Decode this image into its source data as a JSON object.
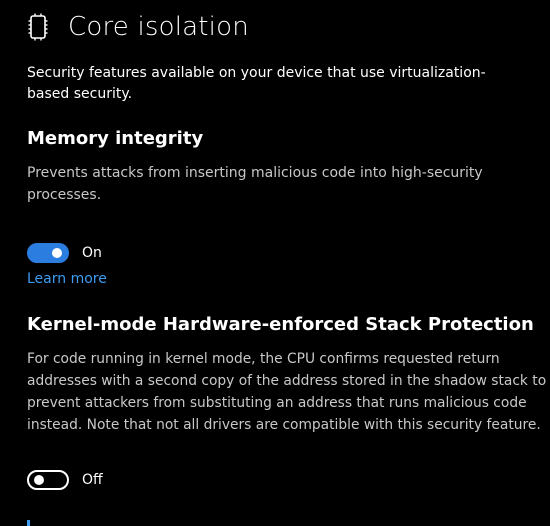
{
  "header": {
    "icon": "chip-icon",
    "title": "Core isolation"
  },
  "description": "Security features available on your device that use virtualization-based security.",
  "memory_integrity": {
    "title": "Memory integrity",
    "description": "Prevents attacks from inserting malicious code into high-security processes.",
    "toggle_state": "on",
    "toggle_label": "On",
    "learn_more": "Learn more"
  },
  "stack_protection": {
    "title": "Kernel-mode Hardware-enforced Stack Protection",
    "description": "For code running in kernel mode, the CPU confirms requested return addresses with a second copy of the address stored in the shadow stack to prevent attackers from substituting an address that runs malicious code instead. Note that not all drivers are compatible with this security feature.",
    "toggle_state": "off",
    "toggle_label": "Off"
  },
  "colors": {
    "background": "#000000",
    "accent": "#2b7de0",
    "link": "#3b9cf2",
    "secondary_text": "#c8c8c8"
  }
}
